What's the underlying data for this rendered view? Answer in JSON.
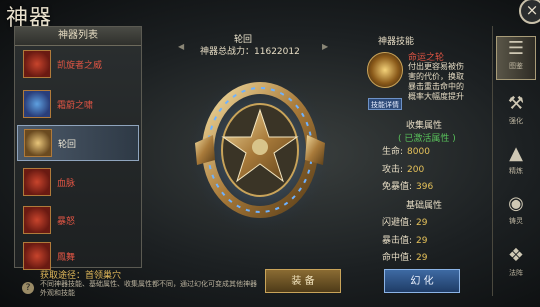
{
  "window": {
    "title": "神器",
    "close_glyph": "×"
  },
  "artifact_list": {
    "header": "神器列表",
    "items": [
      {
        "label": "凯旋者之威",
        "icon": "red-weapon-icon"
      },
      {
        "label": "霜蔚之啸",
        "icon": "blue-gem-icon"
      },
      {
        "label": "轮回",
        "icon": "gold-emblem-icon",
        "selected": true
      },
      {
        "label": "血脉",
        "icon": "red-armor-icon"
      },
      {
        "label": "暴怒",
        "icon": "red-blade-icon"
      },
      {
        "label": "鳳舞",
        "icon": "red-wing-icon"
      }
    ]
  },
  "acquire": "获取途径：首领巢穴",
  "description": "不同神器技能、基础属性、收集属性都不同，通过幻化可变成其他神器外观和技能",
  "center": {
    "name": "轮回",
    "power_label": "神器总战力：",
    "power_value": "11622012",
    "prev_arrow": "◀",
    "next_arrow": "▶"
  },
  "buttons": {
    "equip": "装 备",
    "transform": "幻 化"
  },
  "skill": {
    "title": "神器技能",
    "name": "命运之轮",
    "description": "付出更容易被伤害的代价，换取暴击重击命中的概率大幅度提升",
    "detail_button": "技能详情"
  },
  "collection": {
    "title": "收集属性",
    "status": "( 已激活属性 )",
    "stats": [
      {
        "label": "生命:",
        "value": "8000"
      },
      {
        "label": "攻击:",
        "value": "200"
      },
      {
        "label": "免暴值:",
        "value": "396"
      }
    ]
  },
  "base": {
    "title": "基础属性",
    "stats": [
      {
        "label": "闪避值:",
        "value": "29"
      },
      {
        "label": "暴击值:",
        "value": "29"
      },
      {
        "label": "命中值:",
        "value": "29"
      }
    ]
  },
  "tabs": [
    {
      "label": "图鉴",
      "icon": "book-icon",
      "active": true
    },
    {
      "label": "强化",
      "icon": "hammer-icon"
    },
    {
      "label": "精炼",
      "icon": "anvil-icon"
    },
    {
      "label": "铸灵",
      "icon": "spirit-icon"
    },
    {
      "label": "法阵",
      "icon": "array-icon"
    }
  ],
  "colors": {
    "accent_gold": "#e6c25a",
    "accent_red": "#e25544",
    "activated_green": "#58c05a"
  }
}
